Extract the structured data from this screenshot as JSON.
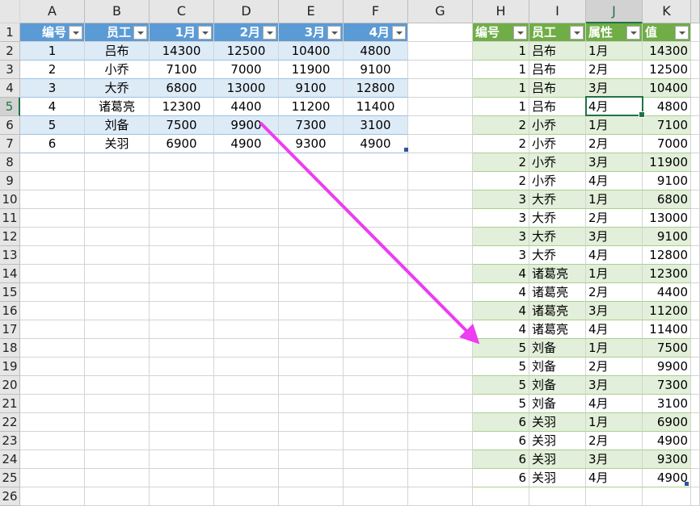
{
  "columns": [
    "A",
    "B",
    "C",
    "D",
    "E",
    "F",
    "G",
    "H",
    "I",
    "J",
    "K"
  ],
  "selected_cell": "J5",
  "table1": {
    "headers": [
      "编号",
      "员工",
      "1月",
      "2月",
      "3月",
      "4月"
    ],
    "rows": [
      [
        "1",
        "吕布",
        "14300",
        "12500",
        "10400",
        "4800"
      ],
      [
        "2",
        "小乔",
        "7100",
        "7000",
        "11900",
        "9100"
      ],
      [
        "3",
        "大乔",
        "6800",
        "13000",
        "9100",
        "12800"
      ],
      [
        "4",
        "诸葛亮",
        "12300",
        "4400",
        "11200",
        "11400"
      ],
      [
        "5",
        "刘备",
        "7500",
        "9900",
        "7300",
        "3100"
      ],
      [
        "6",
        "关羽",
        "6900",
        "4900",
        "9300",
        "4900"
      ]
    ]
  },
  "table2": {
    "headers": [
      "编号",
      "员工",
      "属性",
      "值"
    ],
    "rows": [
      [
        "1",
        "吕布",
        "1月",
        "14300"
      ],
      [
        "1",
        "吕布",
        "2月",
        "12500"
      ],
      [
        "1",
        "吕布",
        "3月",
        "10400"
      ],
      [
        "1",
        "吕布",
        "4月",
        "4800"
      ],
      [
        "2",
        "小乔",
        "1月",
        "7100"
      ],
      [
        "2",
        "小乔",
        "2月",
        "7000"
      ],
      [
        "2",
        "小乔",
        "3月",
        "11900"
      ],
      [
        "2",
        "小乔",
        "4月",
        "9100"
      ],
      [
        "3",
        "大乔",
        "1月",
        "6800"
      ],
      [
        "3",
        "大乔",
        "2月",
        "13000"
      ],
      [
        "3",
        "大乔",
        "3月",
        "9100"
      ],
      [
        "3",
        "大乔",
        "4月",
        "12800"
      ],
      [
        "4",
        "诸葛亮",
        "1月",
        "12300"
      ],
      [
        "4",
        "诸葛亮",
        "2月",
        "4400"
      ],
      [
        "4",
        "诸葛亮",
        "3月",
        "11200"
      ],
      [
        "4",
        "诸葛亮",
        "4月",
        "11400"
      ],
      [
        "5",
        "刘备",
        "1月",
        "7500"
      ],
      [
        "5",
        "刘备",
        "2月",
        "9900"
      ],
      [
        "5",
        "刘备",
        "3月",
        "7300"
      ],
      [
        "5",
        "刘备",
        "4月",
        "3100"
      ],
      [
        "6",
        "关羽",
        "1月",
        "6900"
      ],
      [
        "6",
        "关羽",
        "2月",
        "4900"
      ],
      [
        "6",
        "关羽",
        "3月",
        "9300"
      ],
      [
        "6",
        "关羽",
        "4月",
        "4900"
      ]
    ]
  },
  "colors": {
    "blue_header": "#5b9bd5",
    "blue_band": "#ddebf7",
    "green_header": "#70ad47",
    "green_band": "#e2efda",
    "arrow": "#ee3cf0"
  }
}
